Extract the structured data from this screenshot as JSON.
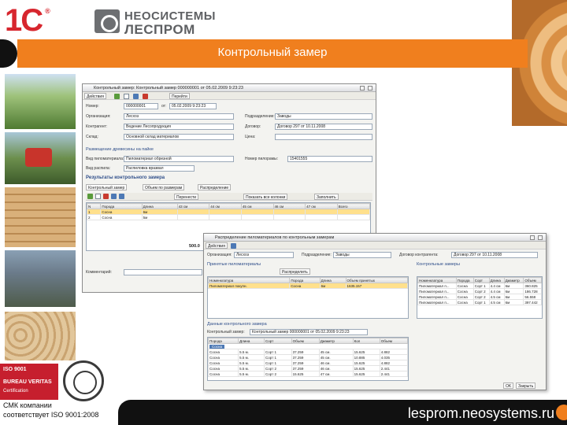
{
  "branding": {
    "logo_1c": "1С",
    "reg_mark": "®",
    "company_line1": "НЕОСИСТЕМЫ",
    "company_line2": "ЛЕСПРОМ"
  },
  "slide": {
    "title": "Контрольный замер",
    "footer_url": "lesprom.neosystems.ru",
    "cmk_line1": "СМК компании",
    "cmk_line2": "соответствует ISO 9001:2008",
    "iso_line1": "ISO 9001",
    "iso_line2": "BUREAU VERITAS",
    "iso_line3": "Certification",
    "colors": {
      "accent": "#f07f1e",
      "iso_red": "#c61f2e",
      "footer": "#111111"
    }
  },
  "main_window": {
    "title": "Контрольный замер: Контрольный замер 000000001 от 05.02.2009 9:23:23",
    "toolbar": {
      "actions": "Действия",
      "goto": "Перейти"
    },
    "fields": {
      "number_label": "Номер:",
      "number_value": "000000001",
      "date_label": "от:",
      "date_value": "05.02.2009 9:23:23",
      "org_label": "Организация:",
      "org_value": "Лесхоз",
      "dept_label": "Подразделение:",
      "dept_value": "Заводы",
      "counterparty_label": "Контрагент:",
      "counterparty_value": "Ведение Лесопродукция",
      "contract_label": "Договор:",
      "contract_value": "Договор 297 от 10.11.2008",
      "warehouse_label": "Склад:",
      "warehouse_value": "Основной склад материалов",
      "price_label": "Цена:",
      "price_value": ""
    },
    "timber_section": "Размещение древесины на пайке",
    "timber_type_label": "Вид пиломатериала:",
    "timber_type_value": "Пиломатериал обрезной",
    "timber_no_label": "Номер пилорамы:",
    "timber_no_value": "15401555",
    "stamp_label": "Вид распила:",
    "stamp_value": "Распиловка вразвал",
    "results_title": "Результаты контрольного замера",
    "tabs": [
      "Контрольный замер",
      "Объем по размерам",
      "Распределение"
    ],
    "sub_toolbar": [
      "Перенести",
      "Показать все колонки",
      "Заполнить"
    ],
    "grid": {
      "columns": [
        "N",
        "Порода",
        "Длина",
        "43 см",
        "44 см",
        "45 см",
        "46 см",
        "47 см",
        "Всего"
      ],
      "rows": [
        [
          "1",
          "Сосна",
          "6м",
          "",
          "",
          "",
          "",
          "",
          ""
        ],
        [
          "2",
          "Сосна",
          "5м",
          "",
          "",
          "",
          "",
          "",
          ""
        ]
      ],
      "total": "500.0"
    },
    "comment_label": "Комментарий:"
  },
  "second_window": {
    "title": "Распределение пиломатериалов по контрольным замерам",
    "toolbar": {
      "actions": "Действия"
    },
    "fields": {
      "org_label": "Организация:",
      "org_value": "Лесхоз",
      "dept_label": "Подразделение:",
      "dept_value": "Заводы",
      "contract_label": "Договор контрагента:",
      "contract_value": "Договор 297 от 10.11.2008"
    },
    "accepted_section": "Принятые пиломатериалы",
    "distribute_label": "Распределить",
    "left_grid": {
      "columns": [
        "Номенклатура",
        "Порода",
        "Длина",
        "Объем принятых"
      ],
      "rows": [
        [
          "Пиломатериал покупн.",
          "Сосна",
          "6м",
          "1635.157"
        ]
      ]
    },
    "control_section": "Контрольные замеры",
    "right_grid": {
      "columns": [
        "Номенклатура",
        "Порода",
        "Сорт",
        "Длина",
        "Диаметр",
        "Объем"
      ],
      "rows": [
        [
          "Пиломатериал п...",
          "Сосна",
          "Сорт 1",
          "4.4 см",
          "6м",
          "360.825"
        ],
        [
          "Пиломатериал п...",
          "Сосна",
          "Сорт 2",
          "4.4 см",
          "6м",
          "186.728"
        ],
        [
          "Пиломатериал п...",
          "Сосна",
          "Сорт 2",
          "4.5 см",
          "6м",
          "56.558"
        ],
        [
          "Пиломатериал п...",
          "Сосна",
          "Сорт 1",
          "4.5 см",
          "6м",
          "397.442"
        ]
      ]
    },
    "bottom_section": "Данные контрольного замера",
    "bottom_select_label": "Контрольный замер:",
    "bottom_select_value": "Контрольный замер 000000001 от 05.02.2009 9:23:23",
    "bottom_grid": {
      "columns": [
        "Порода",
        "Длина",
        "Сорт",
        "Объем",
        "Диаметр",
        "Кол",
        "Объем",
        "%"
      ],
      "group_label": "Сосна",
      "rows": [
        [
          "Сосна",
          "5.5 м.",
          "Сорт 1",
          "37.259",
          "45 см.",
          "15.625",
          "4.882"
        ],
        [
          "Сосна",
          "5.5 м.",
          "Сорт 1",
          "37.259",
          "45 см.",
          "10.885",
          "4.035"
        ],
        [
          "Сосна",
          "5.5 м.",
          "Сорт 1",
          "37.259",
          "46 см.",
          "15.625",
          "4.882"
        ],
        [
          "Сосна",
          "5.5 м.",
          "Сорт 2",
          "37.259",
          "46 см.",
          "15.625",
          "2.441"
        ],
        [
          "Сосна",
          "5.5 м.",
          "Сорт 2",
          "15.625",
          "47 см.",
          "15.625",
          "2.441"
        ]
      ]
    },
    "ok_label": "OK",
    "close_label": "Закрыть"
  }
}
